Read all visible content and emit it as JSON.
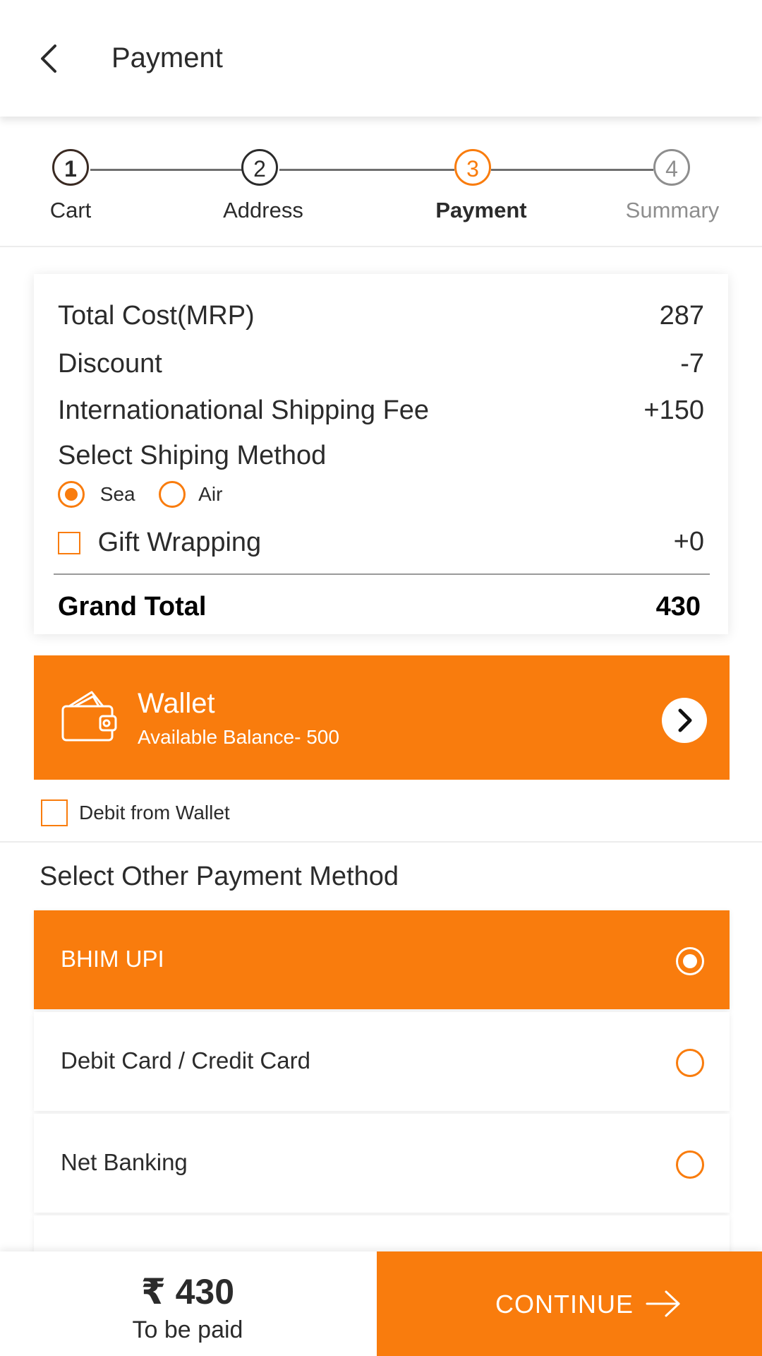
{
  "header": {
    "title": "Payment",
    "back_icon": "chevron-left-icon"
  },
  "stepper": {
    "steps": [
      {
        "number": "1",
        "label": "Cart",
        "state": "done"
      },
      {
        "number": "2",
        "label": "Address",
        "state": "done"
      },
      {
        "number": "3",
        "label": "Payment",
        "state": "active"
      },
      {
        "number": "4",
        "label": "Summary",
        "state": "upcoming"
      }
    ]
  },
  "summary": {
    "total_cost_label": "Total Cost(MRP)",
    "total_cost_value": "287",
    "discount_label": "Discount",
    "discount_value": "-7",
    "shipping_fee_label": "Internationational Shipping Fee",
    "shipping_fee_value": "+150",
    "shipping_method_label": "Select Shiping Method",
    "shipping_methods": [
      {
        "label": "Sea",
        "selected": true
      },
      {
        "label": "Air",
        "selected": false
      }
    ],
    "gift_wrapping_label": "Gift Wrapping",
    "gift_wrapping_value": "+0",
    "gift_wrapping_checked": false,
    "grand_total_label": "Grand Total",
    "grand_total_value": "430"
  },
  "wallet": {
    "title": "Wallet",
    "balance": "Available Balance- 500",
    "icon": "wallet-icon",
    "arrow_icon": "chevron-right-icon",
    "debit_label": "Debit from Wallet",
    "debit_checked": false
  },
  "payment_methods": {
    "title": "Select Other Payment Method",
    "options": [
      {
        "label": "BHIM UPI",
        "selected": true
      },
      {
        "label": "Debit Card / Credit Card",
        "selected": false
      },
      {
        "label": "Net Banking",
        "selected": false
      }
    ]
  },
  "footer": {
    "amount": "₹ 430",
    "subtitle": "To be paid",
    "continue_label": "CONTINUE",
    "continue_icon": "arrow-right-icon"
  },
  "colors": {
    "accent": "#f97c0d",
    "text": "#2b2b2b",
    "muted": "#8e8e8e"
  }
}
